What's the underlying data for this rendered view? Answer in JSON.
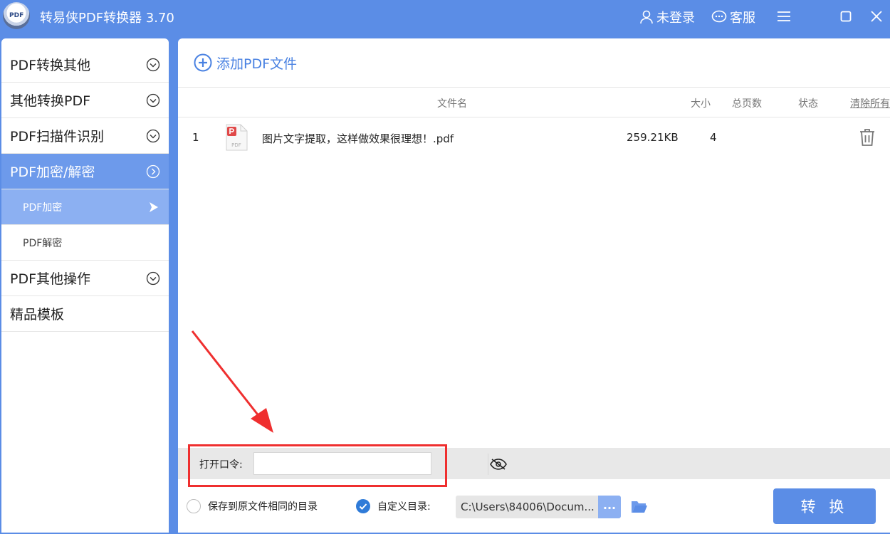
{
  "app": {
    "title": "转易侠PDF转换器 3.70",
    "logo_text": "PDF"
  },
  "titlebar": {
    "login": "未登录",
    "service": "客服"
  },
  "sidebar": {
    "items": [
      {
        "label": "PDF转换其他"
      },
      {
        "label": "其他转换PDF"
      },
      {
        "label": "PDF扫描件识别"
      },
      {
        "label": "PDF加密/解密"
      },
      {
        "label": "PDF其他操作"
      },
      {
        "label": "精品模板"
      }
    ],
    "subitems": [
      {
        "label": "PDF加密"
      },
      {
        "label": "PDF解密"
      }
    ]
  },
  "main": {
    "add_label": "添加PDF文件",
    "columns": {
      "name": "文件名",
      "size": "大小",
      "pages": "总页数",
      "status": "状态",
      "clear": "清除所有"
    },
    "files": [
      {
        "index": "1",
        "name": "图片文字提取，这样做效果很理想！.pdf",
        "size": "259.21KB",
        "pages": "4",
        "icon_text": "PDF"
      }
    ],
    "password": {
      "label": "打开口令:",
      "value": ""
    },
    "options": {
      "same_dir": "保存到原文件相同的目录",
      "custom_dir": "自定义目录:",
      "path": "C:\\Users\\84006\\Docum...",
      "browse": "..."
    },
    "convert_label": "转 换"
  },
  "colors": {
    "brand": "#5b8de6",
    "active": "#6d9aeb",
    "selected": "#8cb0f2",
    "annotation": "#ef2f2f"
  }
}
